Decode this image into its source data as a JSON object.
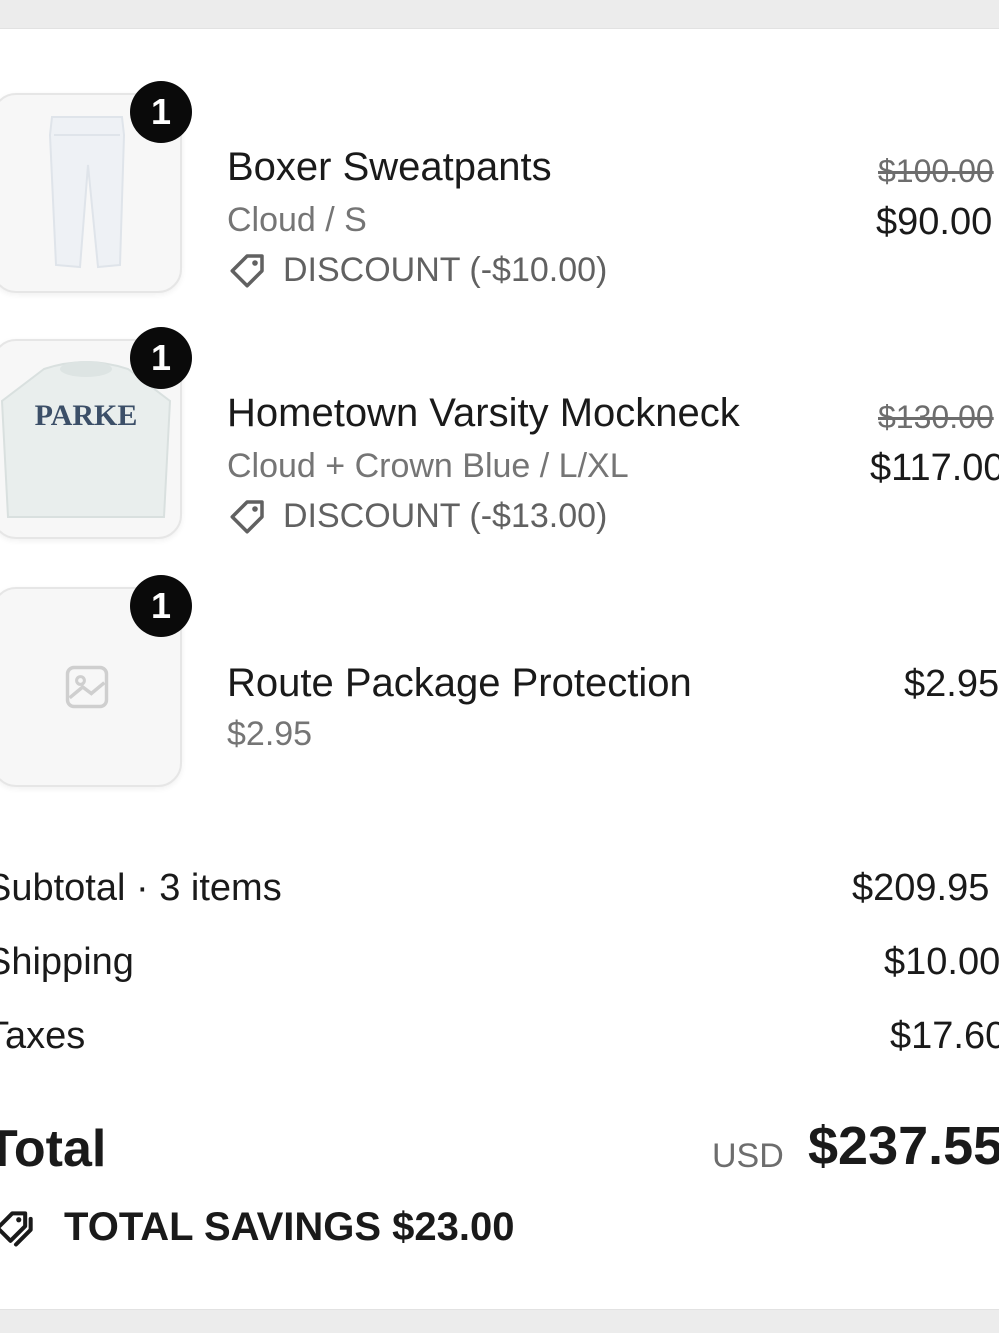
{
  "items": [
    {
      "quantity": "1",
      "name": "Boxer Sweatpants",
      "variant": "Cloud / S",
      "discount": "DISCOUNT (-$10.00)",
      "original_price": "$100.00",
      "price": "$90.00",
      "image": "white-sweatpants"
    },
    {
      "quantity": "1",
      "name": "Hometown Varsity Mockneck",
      "variant": "Cloud + Crown Blue / L/XL",
      "discount": "DISCOUNT (-$13.00)",
      "original_price": "$130.00",
      "price": "$117.00",
      "image": "varsity-sweatshirt",
      "image_text": "PARKE"
    },
    {
      "quantity": "1",
      "name": "Route Package Protection",
      "variant": "$2.95",
      "price": "$2.95",
      "image": "image-placeholder-icon"
    }
  ],
  "summary": {
    "subtotal_label": "Subtotal · 3 items",
    "subtotal_value": "$209.95",
    "shipping_label": "Shipping",
    "shipping_value": "$10.00",
    "taxes_label": "Taxes",
    "taxes_value": "$17.60",
    "total_label": "Total",
    "currency": "USD",
    "total_value": "$237.55",
    "savings": "TOTAL SAVINGS $23.00"
  },
  "icons": {
    "discount": "tag-icon",
    "savings": "tags-icon",
    "placeholder": "image-placeholder-icon"
  }
}
